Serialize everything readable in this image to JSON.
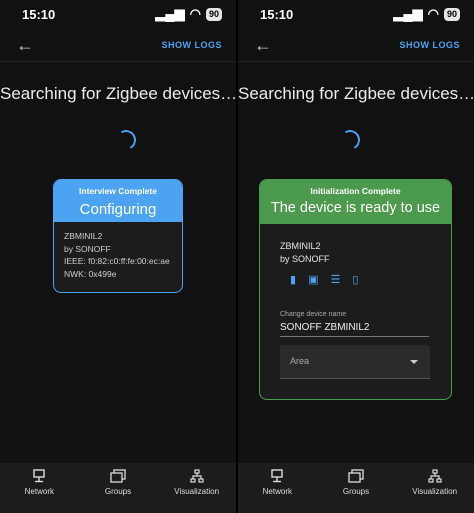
{
  "colors": {
    "accent": "#4ba3f2",
    "success": "#4c9a4e",
    "background": "#111111",
    "card": "#1c1c1c"
  },
  "status": {
    "time": "15:10",
    "battery": "90"
  },
  "appbar": {
    "back_icon": "arrow-back-icon",
    "show_logs": "SHOW LOGS"
  },
  "search_heading": "Searching for Zigbee devices…",
  "left_card": {
    "status": "Interview Complete",
    "state": "Configuring",
    "model": "ZBMINIL2",
    "manufacturer": "by SONOFF",
    "ieee": "IEEE: f0:82:c0:ff:fe:00:ec:ae",
    "nwk": "NWK: 0x499e"
  },
  "right_card": {
    "status": "Initialization Complete",
    "message": "The device is ready to use",
    "model": "ZBMINIL2",
    "manufacturer": "by SONOFF",
    "icons": [
      "battery-icon",
      "device-icon",
      "list-icon",
      "remote-icon"
    ],
    "name_label": "Change device name",
    "name_value": "SONOFF ZBMINIL2",
    "area_label": "Area"
  },
  "nav": {
    "items": [
      {
        "label": "Network",
        "icon": "network-icon"
      },
      {
        "label": "Groups",
        "icon": "groups-icon"
      },
      {
        "label": "Visualization",
        "icon": "visualization-icon"
      }
    ]
  }
}
